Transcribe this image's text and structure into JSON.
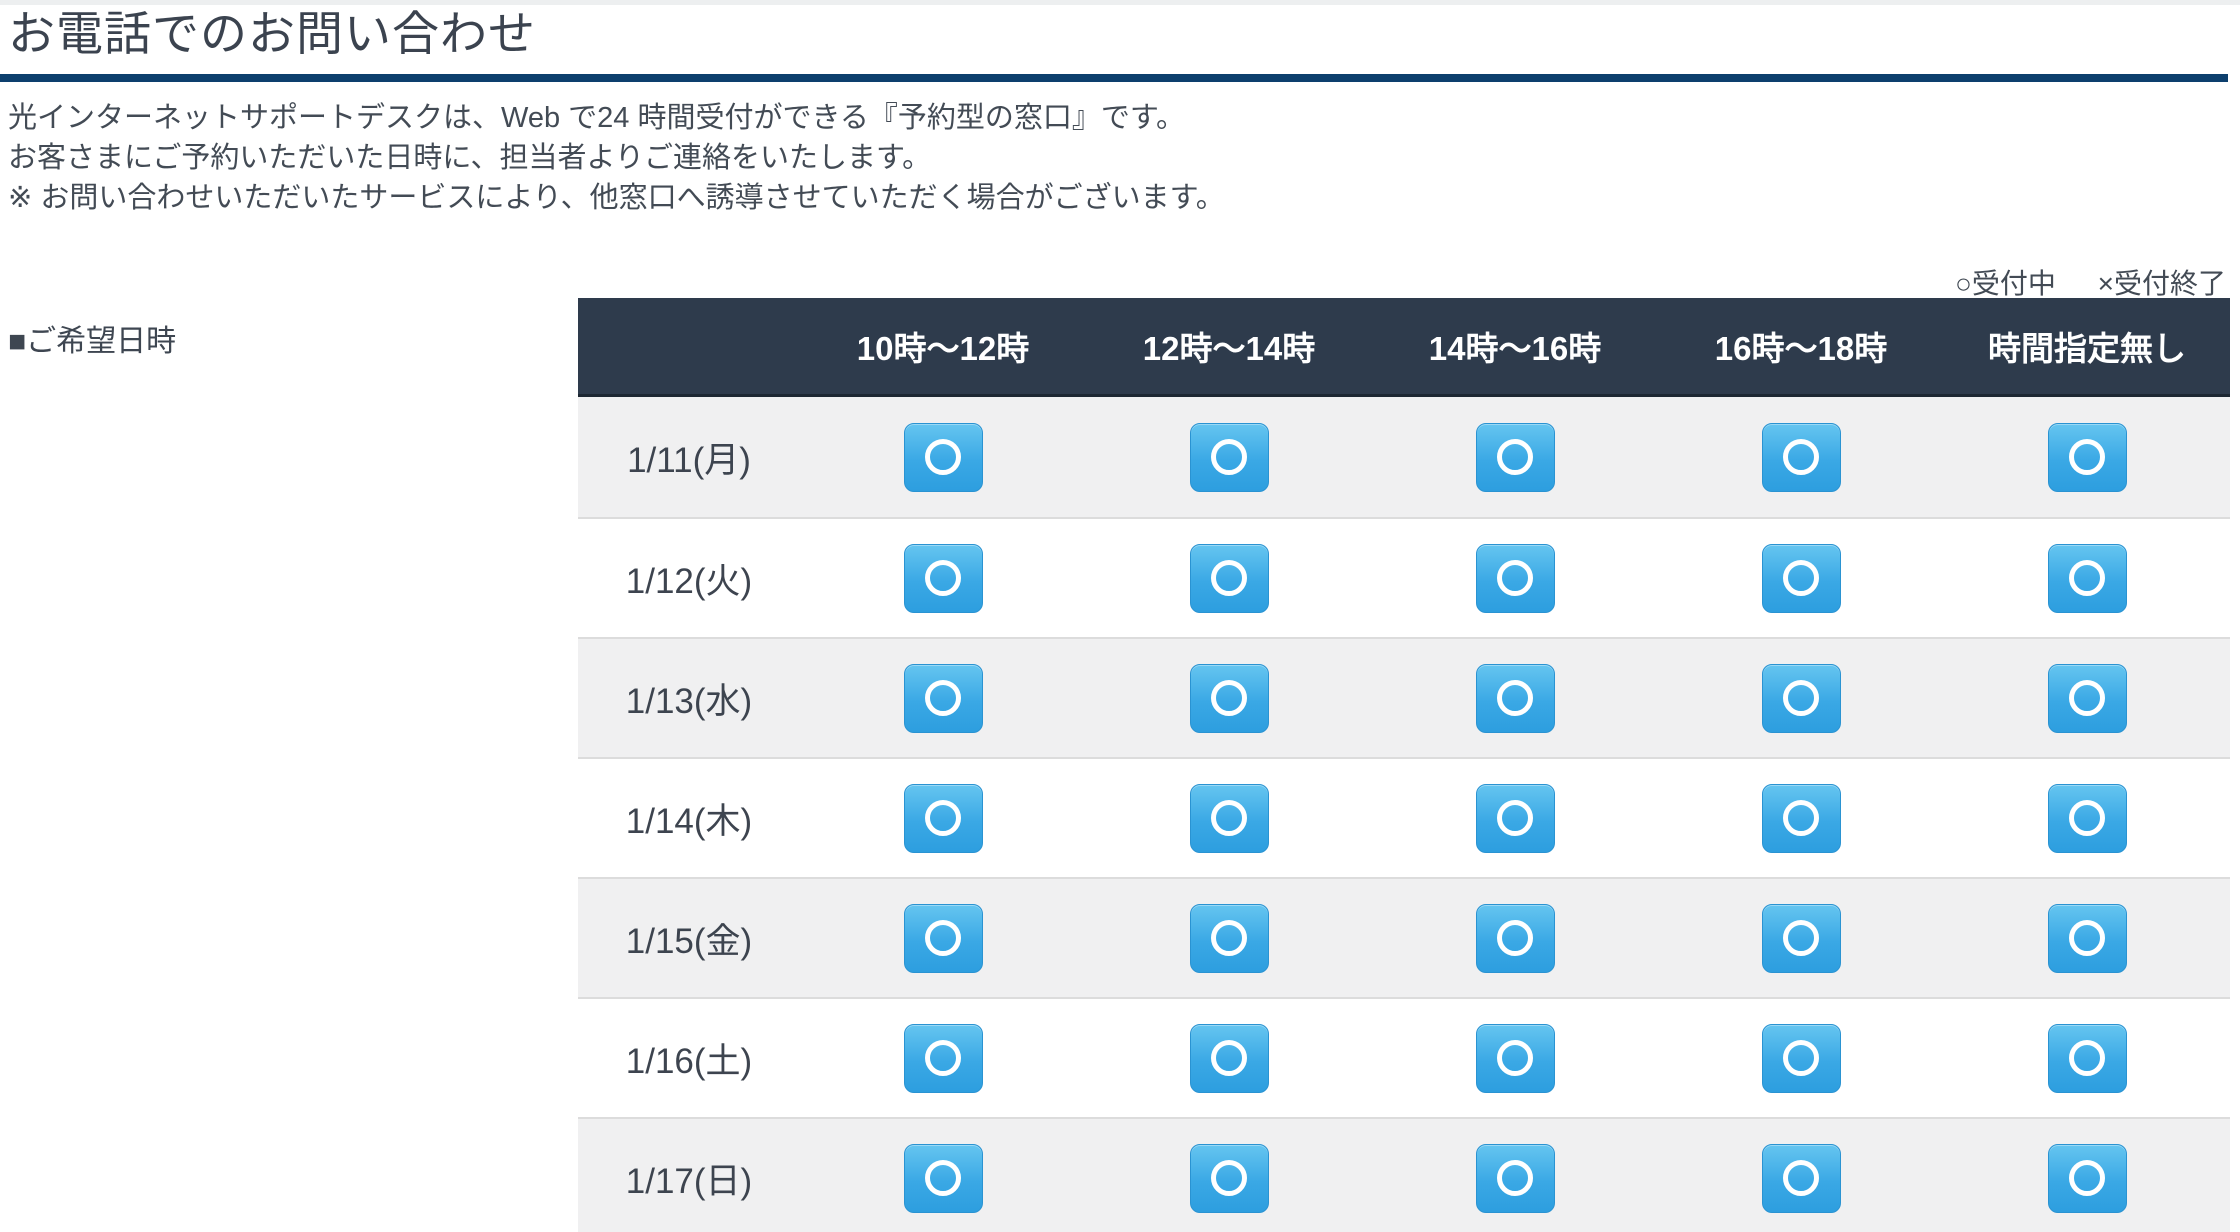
{
  "title": "お電話でのお問い合わせ",
  "intro": {
    "line1": "光インターネットサポートデスクは、Web で24 時間受付ができる『予約型の窓口』です。",
    "line2": "お客さまにご予約いただいた日時に、担当者よりご連絡をいたします。",
    "line3": "※ お問い合わせいただいたサービスにより、他窓口へ誘導させていただく場合がございます。"
  },
  "legend": {
    "accepting": "○受付中",
    "closed": "×受付終了"
  },
  "field_label": "■ご希望日時",
  "schedule": {
    "time_headers": [
      "10時〜12時",
      "12時〜14時",
      "14時〜16時",
      "16時〜18時",
      "時間指定無し"
    ],
    "open_symbol": "○",
    "closed_symbol": "×",
    "rows": [
      {
        "date": "1/11(月)",
        "slots": [
          "open",
          "open",
          "open",
          "open",
          "open"
        ]
      },
      {
        "date": "1/12(火)",
        "slots": [
          "open",
          "open",
          "open",
          "open",
          "open"
        ]
      },
      {
        "date": "1/13(水)",
        "slots": [
          "open",
          "open",
          "open",
          "open",
          "open"
        ]
      },
      {
        "date": "1/14(木)",
        "slots": [
          "open",
          "open",
          "open",
          "open",
          "open"
        ]
      },
      {
        "date": "1/15(金)",
        "slots": [
          "open",
          "open",
          "open",
          "open",
          "open"
        ]
      },
      {
        "date": "1/16(土)",
        "slots": [
          "open",
          "open",
          "open",
          "open",
          "open"
        ]
      },
      {
        "date": "1/17(日)",
        "slots": [
          "open",
          "open",
          "open",
          "open",
          "open"
        ]
      }
    ]
  },
  "colors": {
    "accent_blue": "#35a3e2",
    "header_bg": "#2e3b4c",
    "title_underline": "#0d3f6d",
    "row_alt_bg": "#f0f0f1",
    "row_separator": "#dcdcdc",
    "text_dark": "#3e4651"
  }
}
